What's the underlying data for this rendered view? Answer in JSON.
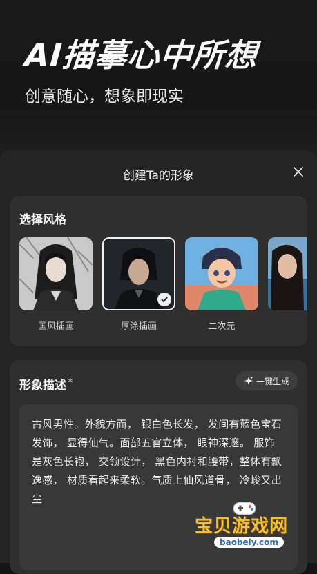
{
  "hero": {
    "title": "AI描摹心中所想",
    "subtitle": "创意随心，想象即现实"
  },
  "sheet": {
    "title": "创建Ta的形象",
    "close_icon": "close-icon"
  },
  "style_section": {
    "label": "选择风格",
    "items": [
      {
        "name": "国风插画",
        "selected": false
      },
      {
        "name": "厚涂插画",
        "selected": true
      },
      {
        "name": "二次元",
        "selected": false
      },
      {
        "name": "",
        "selected": false
      }
    ]
  },
  "description_section": {
    "label": "形象描述",
    "required_mark": "*",
    "generate_button": "一键生成",
    "text": "古风男性。外貌方面， 银白色长发， 发间有蓝色宝石发饰， 显得仙气。面部五官立体， 眼神深邃。 服饰是灰色长袍， 交领设计， 黑色内衬和腰带，整体有飘逸感， 材质看起来柔软。气质上仙风道骨， 冷峻又出尘"
  },
  "watermark": {
    "text": "宝贝游戏网",
    "url": "baobeiy.com"
  },
  "colors": {
    "background": "#141414",
    "sheet": "#242424",
    "card": "#2f2f2f",
    "input": "#383838",
    "watermark": "#f2c22e"
  }
}
